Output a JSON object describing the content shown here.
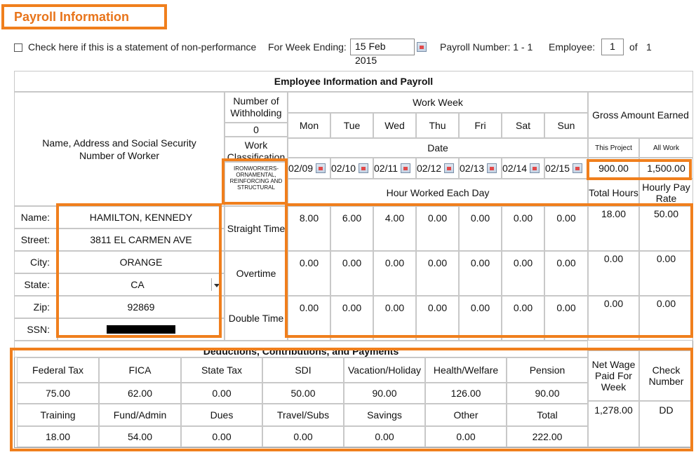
{
  "title": "Payroll Information",
  "top": {
    "nonperf_label": "Check here if this is a statement of non-performance",
    "week_ending_label": "For Week Ending:",
    "week_ending_value": "15 Feb 2015",
    "payroll_number_label": "Payroll Number: 1 - 1",
    "employee_label": "Employee:",
    "employee_value": "1",
    "of_label": "of",
    "of_total": "1"
  },
  "table": {
    "heading": "Employee Information and Payroll",
    "name_header": "Name, Address and Social Security Number of Worker",
    "withholding_label": "Number of Withholding",
    "withholding_value": "0",
    "work_class_label": "Work Classification",
    "work_class_value": "IRONWORKERS- ORNAMENTAL, REINFORCING AND STRUCTURAL",
    "work_week_label": "Work Week",
    "days": [
      "Mon",
      "Tue",
      "Wed",
      "Thu",
      "Fri",
      "Sat",
      "Sun"
    ],
    "date_label": "Date",
    "dates": [
      "02/09",
      "02/10",
      "02/11",
      "02/12",
      "02/13",
      "02/14",
      "02/15"
    ],
    "hours_label": "Hour Worked Each Day",
    "gross_label": "Gross Amount Earned",
    "this_project_label": "This Project",
    "all_work_label": "All Work",
    "this_project_value": "900.00",
    "all_work_value": "1,500.00",
    "total_hours_label": "Total Hours",
    "hourly_rate_label": "Hourly Pay Rate",
    "worker": {
      "name_label": "Name:",
      "name": "HAMILTON, KENNEDY",
      "street_label": "Street:",
      "street": "3811 EL CARMEN AVE",
      "city_label": "City:",
      "city": "ORANGE",
      "state_label": "State:",
      "state": "CA",
      "zip_label": "Zip:",
      "zip": "92869",
      "ssn_label": "SSN:"
    },
    "hour_types": [
      {
        "label": "Straight Time",
        "hours": [
          "8.00",
          "6.00",
          "4.00",
          "0.00",
          "0.00",
          "0.00",
          "0.00"
        ],
        "total": "18.00",
        "rate": "50.00"
      },
      {
        "label": "Overtime",
        "hours": [
          "0.00",
          "0.00",
          "0.00",
          "0.00",
          "0.00",
          "0.00",
          "0.00"
        ],
        "total": "0.00",
        "rate": "0.00"
      },
      {
        "label": "Double Time",
        "hours": [
          "0.00",
          "0.00",
          "0.00",
          "0.00",
          "0.00",
          "0.00",
          "0.00"
        ],
        "total": "0.00",
        "rate": "0.00"
      }
    ],
    "deductions_heading": "Deductions, Contributions, and Payments",
    "deductions_row1_labels": [
      "Federal Tax",
      "FICA",
      "State Tax",
      "SDI",
      "Vacation/Holiday",
      "Health/Welfare",
      "Pension"
    ],
    "deductions_row1_values": [
      "75.00",
      "62.00",
      "0.00",
      "50.00",
      "90.00",
      "126.00",
      "90.00"
    ],
    "deductions_row2_labels": [
      "Training",
      "Fund/Admin",
      "Dues",
      "Travel/Subs",
      "Savings",
      "Other",
      "Total"
    ],
    "deductions_row2_values": [
      "18.00",
      "54.00",
      "0.00",
      "0.00",
      "0.00",
      "0.00",
      "222.00"
    ],
    "net_wage_label": "Net Wage Paid For Week",
    "net_wage_value": "1,278.00",
    "check_number_label": "Check Number",
    "check_number_value": "DD"
  },
  "colors": {
    "highlight": "#f07f1d",
    "title": "#e8741a"
  }
}
